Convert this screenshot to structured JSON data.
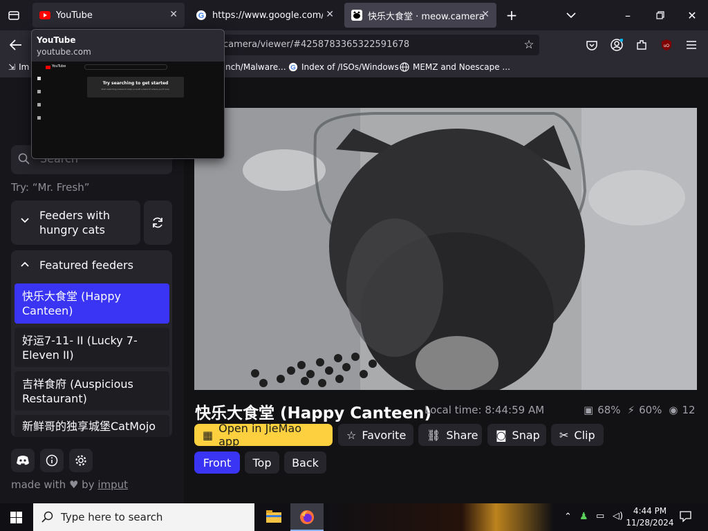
{
  "browser": {
    "tabs": [
      {
        "title": "YouTube",
        "active": false
      },
      {
        "title": "https://www.google.com/searc",
        "active": false
      },
      {
        "title": "快乐大食堂 · meow.camera",
        "active": true
      }
    ],
    "url": "camera/viewer/#4258783365322591678",
    "bookmarks": [
      "Im",
      "nch/Malware...",
      "Index of /ISOs/Windows",
      "MEMZ and Noescape ..."
    ],
    "hover_preview": {
      "title": "YouTube",
      "url": "youtube.com",
      "thumb_logo": "YouTube",
      "thumb_card_title": "Try searching to get started",
      "thumb_card_sub": "Start watching videos to help us build a feed of videos you'll love."
    }
  },
  "sidebar": {
    "search_placeholder": "Search",
    "try_hint": "Try: “Mr. Fresh”",
    "hungry_label": "Feeders with hungry cats",
    "featured_label": "Featured feeders",
    "feeders": [
      {
        "name": "快乐大食堂 (Happy Canteen)",
        "selected": true
      },
      {
        "name": "好运7-11- II (Lucky 7-Eleven II)",
        "selected": false
      },
      {
        "name": "吉祥食府 (Auspicious Restaurant)",
        "selected": false
      },
      {
        "name": "新鲜哥的独享城堡CatMojo",
        "selected": false
      }
    ],
    "made_with": "made with",
    "by": "by",
    "author": "imput"
  },
  "viewer": {
    "title": "快乐大食堂 (Happy Canteen)",
    "local_time": "Local time: 8:44:59 AM",
    "stat_food": "68%",
    "stat_other": "60%",
    "viewers": "12",
    "actions": {
      "open_app": "Open in JieMao app",
      "favorite": "Favorite",
      "share": "Share",
      "snap": "Snap",
      "clip": "Clip"
    },
    "cameras": [
      "Front",
      "Top",
      "Back"
    ]
  },
  "taskbar": {
    "search_placeholder": "Type here to search",
    "time": "4:44 PM",
    "date": "11/28/2024"
  },
  "colors": {
    "accent_blue": "#3a35f5",
    "app_yellow": "#fcd03f"
  }
}
